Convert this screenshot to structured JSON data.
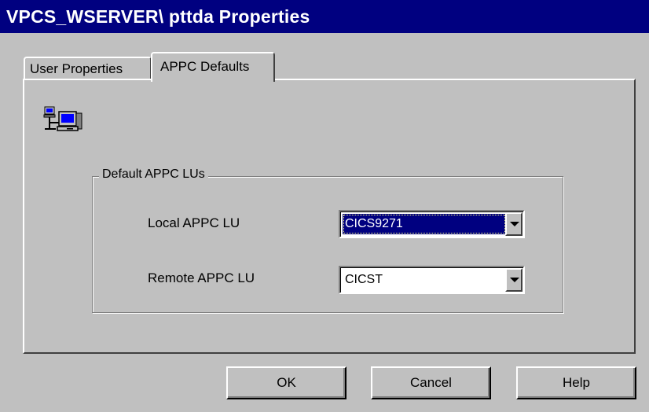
{
  "window": {
    "title": "VPCS_WSERVER\\ pttda Properties"
  },
  "tabs": [
    {
      "label": "User Properties",
      "active": false
    },
    {
      "label": "APPC Defaults",
      "active": true
    }
  ],
  "panel": {
    "icon": "network-computer-icon"
  },
  "group": {
    "legend": "Default APPC LUs",
    "fields": [
      {
        "label": "Local APPC LU",
        "value": "CICS9271",
        "selected": true
      },
      {
        "label": "Remote APPC LU",
        "value": "CICST",
        "selected": false
      }
    ]
  },
  "buttons": {
    "ok": "OK",
    "cancel": "Cancel",
    "help": "Help"
  },
  "colors": {
    "titlebar": "#000080",
    "face": "#c0c0c0",
    "selection": "#000080"
  }
}
